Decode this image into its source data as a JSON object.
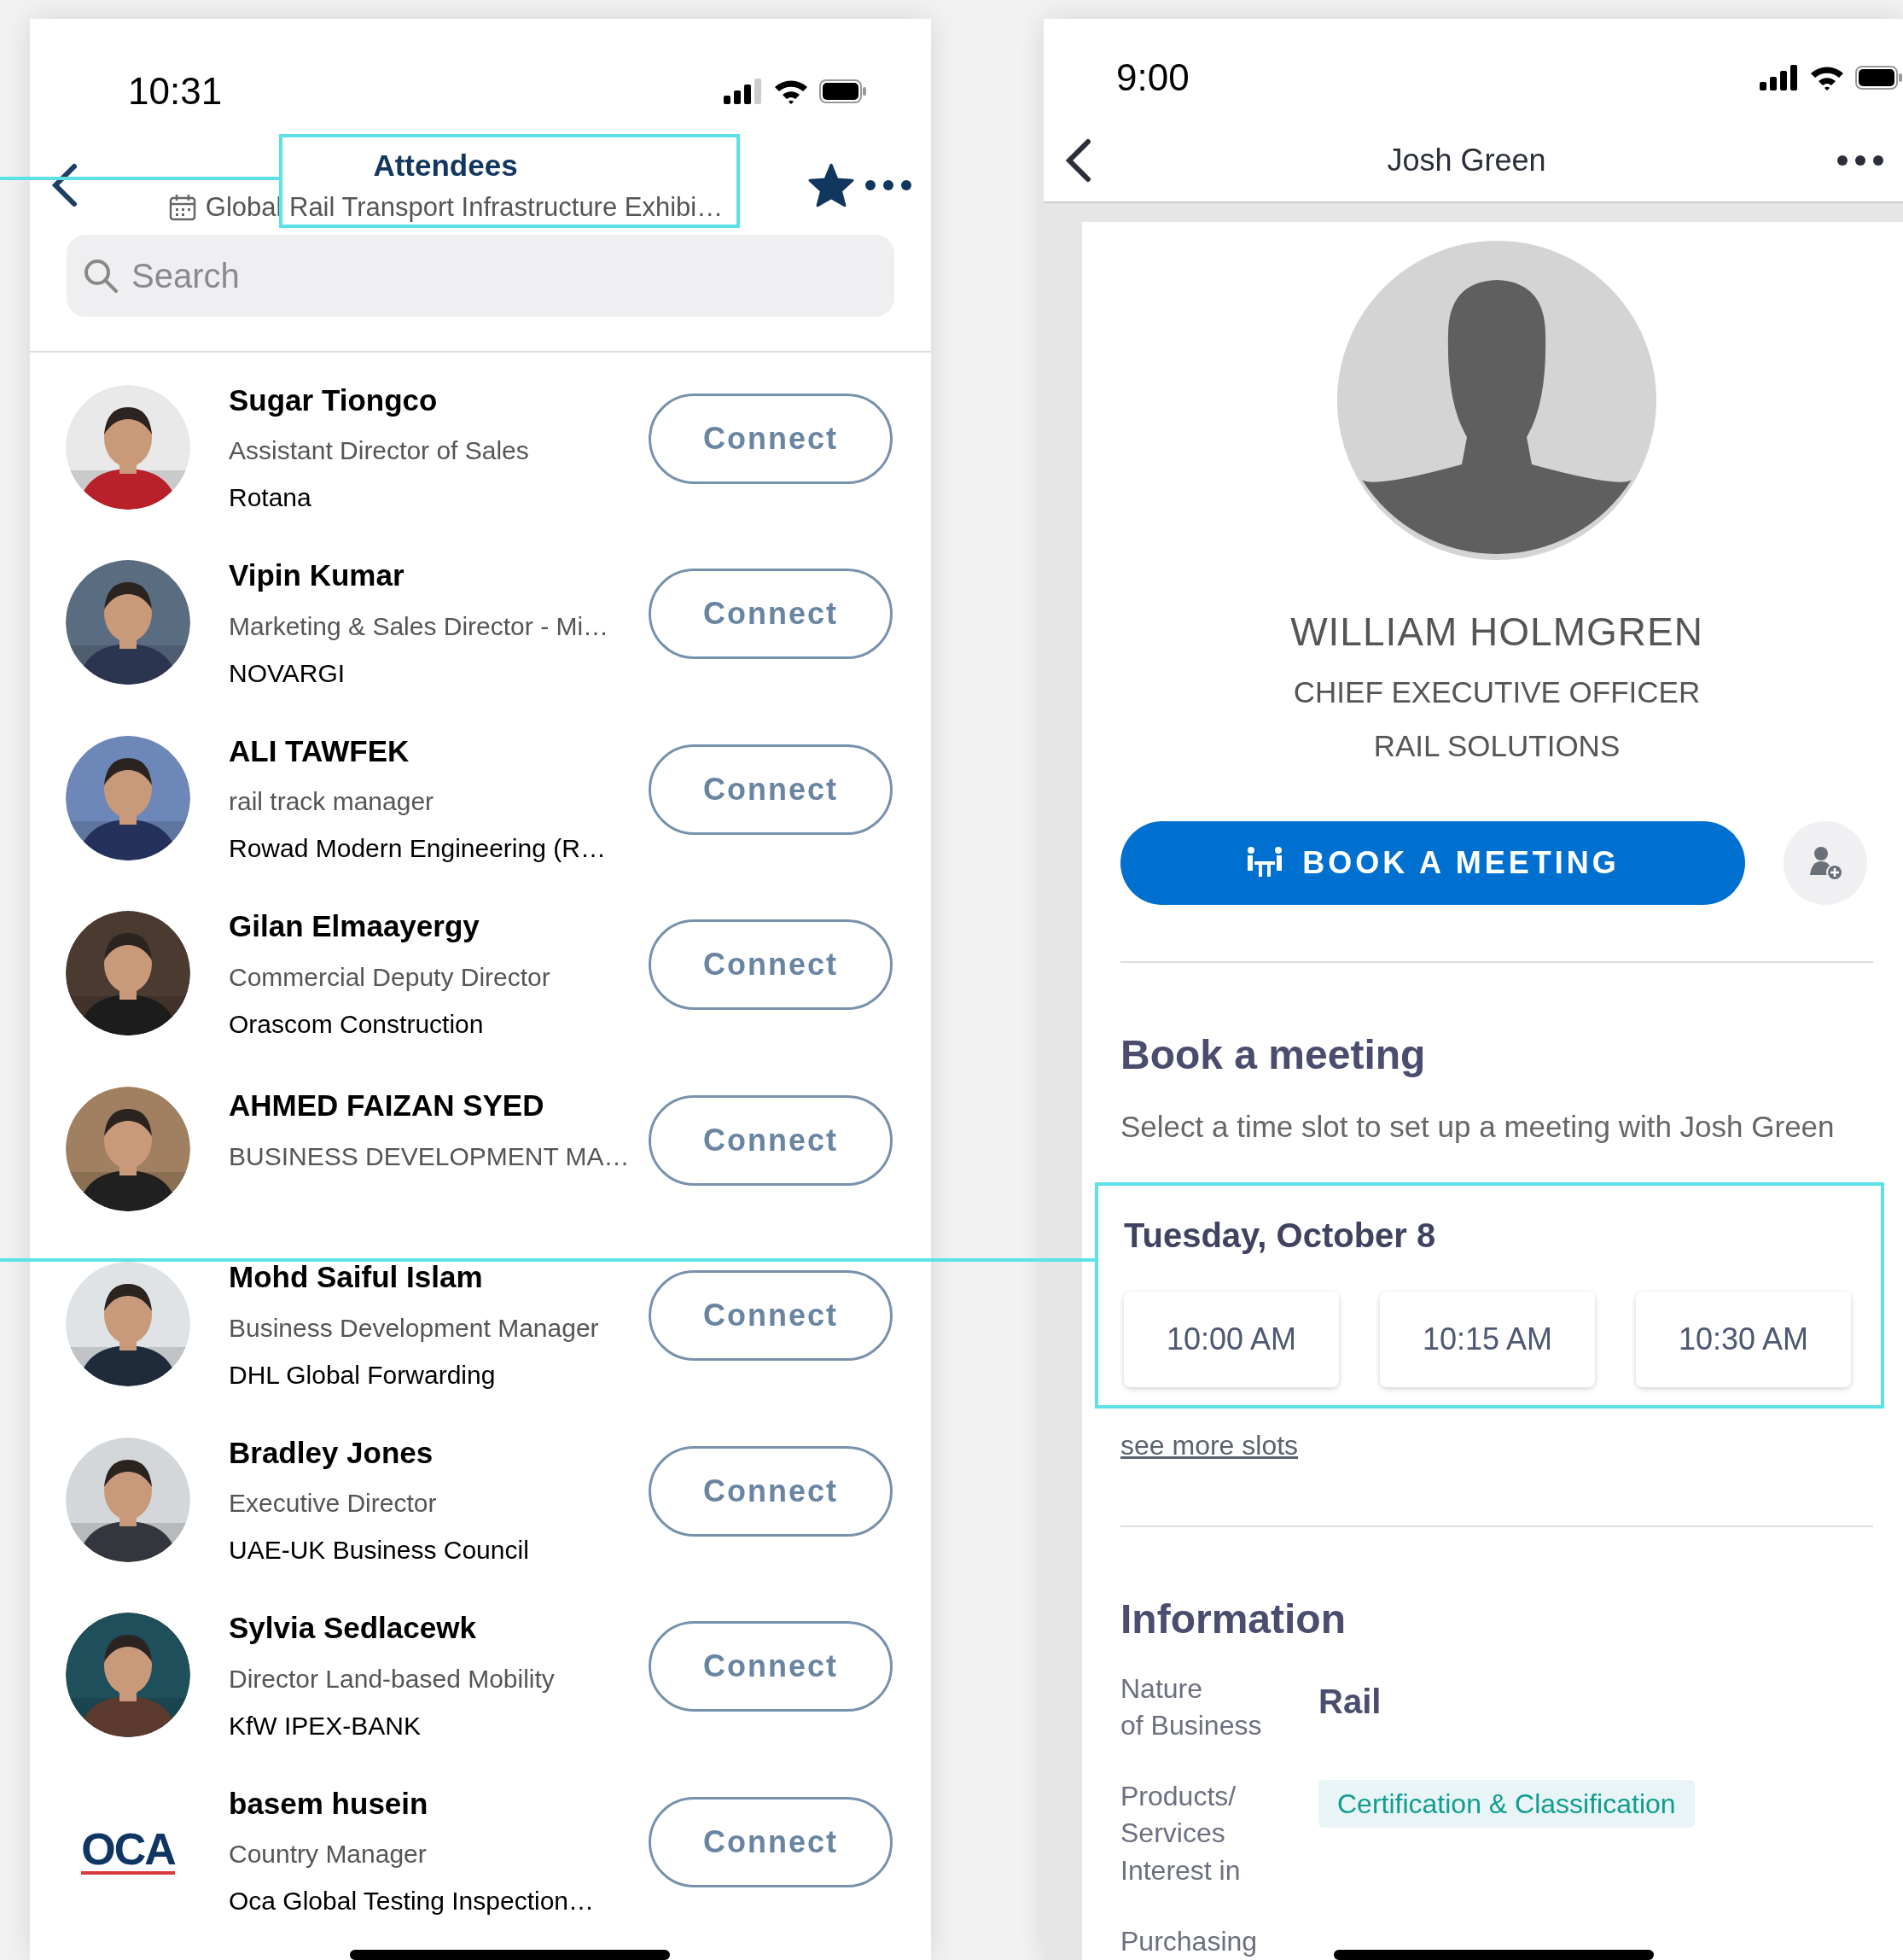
{
  "left_screen": {
    "status_bar": {
      "time": "10:31"
    },
    "header": {
      "title": "Attendees",
      "subtitle": "Global Rail Transport Infrastructure Exhibi…",
      "favorite": {
        "on": true
      }
    },
    "search": {
      "placeholder": "Search"
    },
    "attendees": [
      {
        "name": "Sugar Tiongco",
        "title": "Assistant Director of Sales",
        "company": "Rotana",
        "button": "Connect"
      },
      {
        "name": "Vipin Kumar",
        "title": "Marketing & Sales Director - Mi…",
        "company": "NOVARGI",
        "button": "Connect"
      },
      {
        "name": "ALI TAWFEK",
        "title": "rail track manager",
        "company": "Rowad Modern Engineering (R…",
        "button": "Connect"
      },
      {
        "name": "Gilan Elmaayergy",
        "title": "Commercial Deputy Director",
        "company": "Orascom Construction",
        "button": "Connect"
      },
      {
        "name": "AHMED FAIZAN SYED",
        "title": "BUSINESS DEVELOPMENT MA…",
        "button": "Connect"
      },
      {
        "name": "Mohd Saiful Islam",
        "title": "Business Development Manager",
        "company": "DHL Global Forwarding",
        "button": "Connect"
      },
      {
        "name": "Bradley Jones",
        "title": "Executive Director",
        "company": "UAE-UK Business Council",
        "button": "Connect"
      },
      {
        "name": "Sylvia Sedlacewk",
        "title": "Director Land-based Mobility",
        "company": "KfW IPEX-BANK",
        "button": "Connect"
      },
      {
        "name": "basem husein",
        "title": "Country Manager",
        "company": "Oca Global Testing Inspection…",
        "button": "Connect",
        "avatar": {
          "kind": "logo",
          "text": "OCA"
        }
      }
    ]
  },
  "right_screen": {
    "status_bar": {
      "time": "9:00"
    },
    "header": {
      "title": "Josh Green"
    },
    "profile": {
      "name": "WILLIAM HOLMGREN",
      "job_title": "CHIEF EXECUTIVE OFFICER",
      "company": "RAIL SOLUTIONS",
      "book_button": "BOOK A MEETING"
    },
    "booking": {
      "title": "Book a meeting",
      "subtitle": "Select a time slot to set up a meeting with Josh Green",
      "date": "Tuesday, October 8",
      "slots": [
        "10:00 AM",
        "10:15 AM",
        "10:30 AM"
      ],
      "more_link": "see more slots"
    },
    "information": {
      "title": "Information",
      "fields": [
        {
          "kind": "text",
          "label": "Nature\nof Business",
          "value": "Rail"
        },
        {
          "kind": "tag",
          "label": "Products/\nServices\nInterest in",
          "value": "Certification & Classification"
        },
        {
          "kind": "label",
          "label": "Purchasing"
        }
      ]
    }
  }
}
